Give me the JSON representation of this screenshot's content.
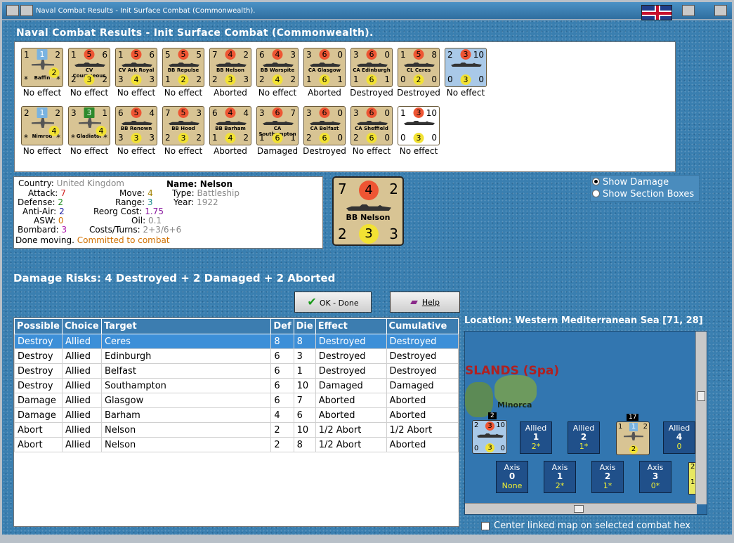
{
  "window": {
    "title": "Naval Combat Results - Init Surface Combat (Commonwealth)."
  },
  "heading": "Naval Combat Results - Init Surface Combat (Commonwealth).",
  "units_row1": [
    {
      "name": "Baffin",
      "tl": "1",
      "mid": "1",
      "tr": "2",
      "bl": "*",
      "bot": "2",
      "br": "*",
      "kind": "plane",
      "mid_style": "sq",
      "result": "No effect"
    },
    {
      "name": "CV Courageous",
      "tl": "1",
      "mid": "5",
      "tr": "6",
      "bl": "2",
      "bot": "3",
      "br": "2",
      "kind": "ship",
      "mid_style": "circle",
      "result": "No effect"
    },
    {
      "name": "CV Ark Royal",
      "tl": "1",
      "mid": "5",
      "tr": "6",
      "bl": "3",
      "bot": "4",
      "br": "3",
      "kind": "ship",
      "mid_style": "circle",
      "result": "No effect"
    },
    {
      "name": "BB Repulse",
      "tl": "5",
      "mid": "5",
      "tr": "5",
      "bl": "1",
      "bot": "2",
      "br": "2",
      "kind": "ship",
      "mid_style": "circle",
      "result": "No effect"
    },
    {
      "name": "BB Nelson",
      "tl": "7",
      "mid": "4",
      "tr": "2",
      "bl": "2",
      "bot": "3",
      "br": "3",
      "kind": "ship",
      "mid_style": "circle",
      "result": "Aborted"
    },
    {
      "name": "BB Warspite",
      "tl": "6",
      "mid": "4",
      "tr": "3",
      "bl": "2",
      "bot": "4",
      "br": "2",
      "kind": "ship",
      "mid_style": "circle",
      "result": "No effect"
    },
    {
      "name": "CA Glasgow",
      "tl": "3",
      "mid": "6",
      "tr": "0",
      "bl": "1",
      "bot": "6",
      "br": "1",
      "kind": "ship",
      "mid_style": "circle",
      "result": "Aborted"
    },
    {
      "name": "CA Edinburgh",
      "tl": "3",
      "mid": "6",
      "tr": "0",
      "bl": "1",
      "bot": "6",
      "br": "1",
      "kind": "ship",
      "mid_style": "circle",
      "result": "Destroyed"
    },
    {
      "name": "CL Ceres",
      "tl": "1",
      "mid": "5",
      "tr": "8",
      "bl": "0",
      "bot": "2",
      "br": "0",
      "kind": "ship",
      "mid_style": "circle",
      "result": "Destroyed"
    },
    {
      "name": "",
      "tl": "2",
      "mid": "3",
      "tr": "10",
      "bl": "0",
      "bot": "3",
      "br": "0",
      "kind": "ship",
      "mid_style": "circle",
      "color": "blue",
      "result": "No effect"
    }
  ],
  "units_row2": [
    {
      "name": "Nimrod",
      "tl": "2",
      "mid": "1",
      "tr": "2",
      "bl": "*",
      "bot": "4",
      "br": "*",
      "kind": "plane",
      "mid_style": "sq",
      "result": "No effect"
    },
    {
      "name": "Gladiator",
      "tl": "3",
      "mid": "3",
      "tr": "1",
      "bl": "*",
      "bot": "4",
      "br": "*",
      "kind": "plane",
      "mid_style": "sqg",
      "result": "No effect"
    },
    {
      "name": "BB Renown",
      "tl": "6",
      "mid": "5",
      "tr": "4",
      "bl": "3",
      "bot": "3",
      "br": "3",
      "kind": "ship",
      "mid_style": "circle",
      "result": "No effect"
    },
    {
      "name": "BB Hood",
      "tl": "7",
      "mid": "5",
      "tr": "3",
      "bl": "2",
      "bot": "3",
      "br": "2",
      "kind": "ship",
      "mid_style": "circle",
      "result": "No effect"
    },
    {
      "name": "BB Barham",
      "tl": "6",
      "mid": "4",
      "tr": "4",
      "bl": "1",
      "bot": "4",
      "br": "2",
      "kind": "ship",
      "mid_style": "circle",
      "result": "Aborted"
    },
    {
      "name": "CA Southampton",
      "tl": "3",
      "mid": "6",
      "tr": "7",
      "bl": "1",
      "bot": "6",
      "br": "1",
      "kind": "ship",
      "mid_style": "circle",
      "result": "Damaged"
    },
    {
      "name": "CA Belfast",
      "tl": "3",
      "mid": "6",
      "tr": "0",
      "bl": "2",
      "bot": "6",
      "br": "0",
      "kind": "ship",
      "mid_style": "circle",
      "result": "Destroyed"
    },
    {
      "name": "CA Sheffield",
      "tl": "3",
      "mid": "6",
      "tr": "0",
      "bl": "2",
      "bot": "6",
      "br": "0",
      "kind": "ship",
      "mid_style": "circle",
      "result": "No effect"
    },
    {
      "name": "",
      "tl": "1",
      "mid": "3",
      "tr": "10",
      "bl": "0",
      "bot": "3",
      "br": "0",
      "kind": "ship",
      "mid_style": "circle",
      "color": "white",
      "result": "No effect"
    }
  ],
  "info": {
    "country_label": "Country:",
    "country": "United Kingdom",
    "attack_label": "Attack:",
    "attack": "7",
    "defense_label": "Defense:",
    "defense": "2",
    "antiair_label": "Anti-Air:",
    "antiair": "2",
    "asw_label": "ASW:",
    "asw": "0",
    "bombard_label": "Bombard:",
    "bombard": "3",
    "move_label": "Move:",
    "move": "4",
    "range_label": "Range:",
    "range": "3",
    "reorg_label": "Reorg Cost:",
    "reorg": "1.75",
    "oil_label": "Oil:",
    "oil": "0.1",
    "costs_label": "Costs/Turns:",
    "costs": "2+3/6+6",
    "name_label": "Name:",
    "name": "Nelson",
    "type_label": "Type:",
    "type": "Battleship",
    "year_label": "Year:",
    "year": "1922",
    "status_done": "Done moving.",
    "status_committed": "Committed to combat"
  },
  "big_counter": {
    "tl": "7",
    "mid": "4",
    "tr": "2",
    "name": "BB Nelson",
    "bl": "2",
    "bot": "3",
    "br": "3"
  },
  "options": {
    "show_damage": "Show Damage",
    "show_sections": "Show Section Boxes"
  },
  "risks": "Damage Risks: 4 Destroyed + 2 Damaged + 2 Aborted",
  "buttons": {
    "ok": "OK - Done",
    "help": "Help"
  },
  "table": {
    "headers": [
      "Possible",
      "Choice",
      "Target",
      "Def",
      "Die",
      "Effect",
      "Cumulative"
    ],
    "rows": [
      [
        "Destroy",
        "Allied",
        "Ceres",
        "8",
        "8",
        "Destroyed",
        "Destroyed"
      ],
      [
        "Destroy",
        "Allied",
        "Edinburgh",
        "6",
        "3",
        "Destroyed",
        "Destroyed"
      ],
      [
        "Destroy",
        "Allied",
        "Belfast",
        "6",
        "1",
        "Destroyed",
        "Destroyed"
      ],
      [
        "Destroy",
        "Allied",
        "Southampton",
        "6",
        "10",
        "Damaged",
        "Damaged"
      ],
      [
        "Damage",
        "Allied",
        "Glasgow",
        "6",
        "7",
        "Aborted",
        "Aborted"
      ],
      [
        "Damage",
        "Allied",
        "Barham",
        "4",
        "6",
        "Aborted",
        "Aborted"
      ],
      [
        "Abort",
        "Allied",
        "Nelson",
        "2",
        "10",
        "1/2 Abort",
        "1/2 Abort"
      ],
      [
        "Abort",
        "Allied",
        "Nelson",
        "2",
        "8",
        "1/2 Abort",
        "Aborted"
      ]
    ]
  },
  "location": "Location:  Western Mediterranean Sea [71, 28]",
  "map": {
    "islands_label": "SLANDS (Spa)",
    "minorca": "Minorca",
    "stack_count": "17",
    "stack2_count": "2",
    "allied_boxes": [
      {
        "label": "Allied",
        "n": "1",
        "v": "2*"
      },
      {
        "label": "Allied",
        "n": "2",
        "v": "1*"
      },
      {
        "label": "Allied",
        "n": "4",
        "v": "0"
      }
    ],
    "axis_boxes": [
      {
        "label": "Axis",
        "n": "0",
        "v": "None"
      },
      {
        "label": "Axis",
        "n": "1",
        "v": "2*"
      },
      {
        "label": "Axis",
        "n": "2",
        "v": "1*"
      },
      {
        "label": "Axis",
        "n": "3",
        "v": "0*"
      }
    ]
  },
  "center_link": "Center linked map on selected combat hex"
}
